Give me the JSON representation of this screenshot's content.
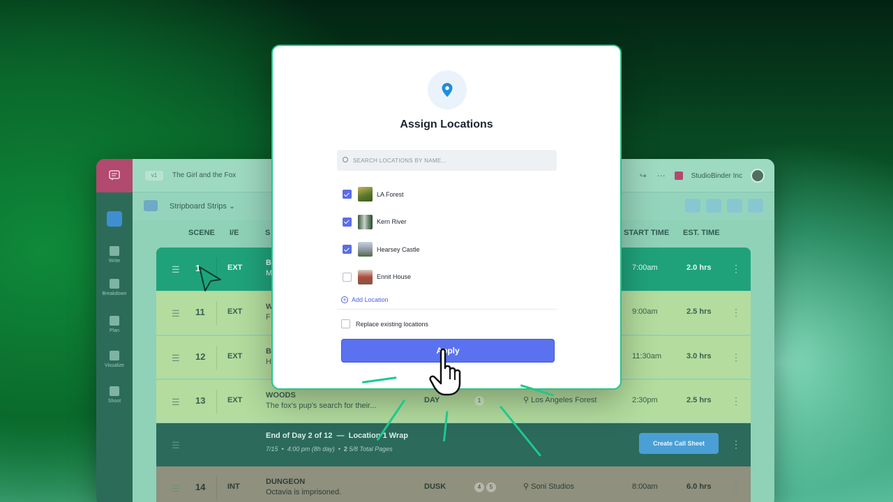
{
  "app": {
    "version": "v1",
    "project_title": "The Girl and the Fox",
    "org_name": "StudioBinder Inc",
    "view_title": "Stripboard Strips",
    "sidebar": [
      {
        "label": "Write"
      },
      {
        "label": "Breakdown"
      },
      {
        "label": "Plan"
      },
      {
        "label": "Visualize"
      },
      {
        "label": "Shoot"
      }
    ]
  },
  "columns": {
    "scene": "SCENE",
    "ie": "I/E",
    "scene_col_partial": "S",
    "start_time": "START TIME",
    "est_time": "EST. TIME"
  },
  "rows": [
    {
      "scene": "1",
      "ie": "EXT",
      "heading": "B",
      "desc": "M",
      "stime": "7:00am",
      "etime": "2.0 hrs"
    },
    {
      "scene": "11",
      "ie": "EXT",
      "heading": "W",
      "desc": "F",
      "stime": "9:00am",
      "etime": "2.5 hrs"
    },
    {
      "scene": "12",
      "ie": "EXT",
      "heading": "B",
      "desc": "H",
      "stime": "11:30am",
      "etime": "3.0 hrs"
    },
    {
      "scene": "13",
      "ie": "EXT",
      "heading": "WOODS",
      "desc": "The fox's pup's search for their...",
      "daynight": "DAY",
      "pages": [
        "1"
      ],
      "location": "Los Angeles Forest",
      "stime": "2:30pm",
      "etime": "2.5 hrs"
    },
    {
      "scene": "14",
      "ie": "INT",
      "heading": "DUNGEON",
      "desc": "Octavia is imprisoned.",
      "daynight": "DUSK",
      "pages": [
        "4",
        "5"
      ],
      "location": "Soni Studios",
      "stime": "8:00am",
      "etime": "6.0 hrs"
    }
  ],
  "end_of_day": {
    "title": "End of Day 2 of 12",
    "wrap": "Location 1 Wrap",
    "date": "7/15",
    "time": "4:00 pm (8h day)",
    "pages_whole": "2",
    "pages_frac": "5/8 Total Pages",
    "button": "Create Call Sheet"
  },
  "modal": {
    "title": "Assign Locations",
    "search_placeholder": "SEARCH LOCATIONS BY NAME...",
    "locations": [
      {
        "name": "LA Forest",
        "checked": true,
        "thumb_color": "#7a8a3c"
      },
      {
        "name": "Kern River",
        "checked": true,
        "thumb_color": "#6f8e72"
      },
      {
        "name": "Hearsey Castle",
        "checked": true,
        "thumb_color": "#8d97a3"
      },
      {
        "name": "Ennit House",
        "checked": false,
        "thumb_color": "#b04a3c"
      }
    ],
    "add_location": "Add Location",
    "replace_label": "Replace existing locations",
    "replace_checked": false,
    "apply_label": "Apply",
    "icon": "map-pin-icon",
    "accent_color": "#5a72f0"
  }
}
